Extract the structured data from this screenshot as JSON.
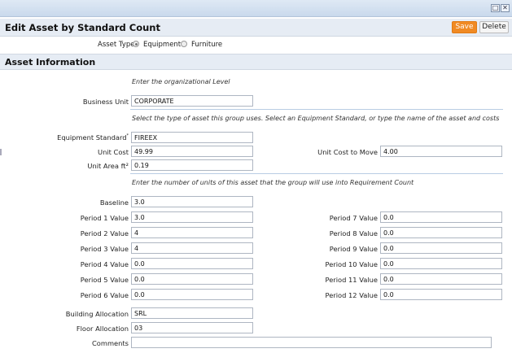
{
  "window": {
    "restore_glyph": "□",
    "close_glyph": "✕"
  },
  "header": {
    "title": "Edit Asset by Standard Count",
    "save_label": "Save",
    "delete_label": "Delete"
  },
  "asset_type": {
    "label": "Asset Type",
    "options": [
      "Equipment",
      "Furniture"
    ],
    "selected": "Equipment"
  },
  "section": {
    "title": "Asset Information"
  },
  "instructions": {
    "org_level": "Enter the organizational Level",
    "asset_type": "Select the type of asset this group uses. Select an Equipment Standard, or type the name of the asset and costs",
    "units": "Enter the number of units of this asset that the group will use into Requirement Count"
  },
  "fields": {
    "business_unit": {
      "label": "Business Unit",
      "value": "CORPORATE"
    },
    "equipment_standard": {
      "label": "Equipment Standard",
      "required_mark": "*",
      "value": "FIREEX"
    },
    "unit_cost": {
      "label": "Unit Cost",
      "value": "49.99"
    },
    "unit_cost_to_move": {
      "label": "Unit Cost to Move",
      "value": "4.00"
    },
    "unit_area": {
      "label": "Unit Area ft²",
      "value": "0.19"
    },
    "baseline": {
      "label": "Baseline",
      "value": "3.0"
    },
    "periods_left": [
      {
        "label": "Period 1 Value",
        "value": "3.0"
      },
      {
        "label": "Period 2 Value",
        "value": "4"
      },
      {
        "label": "Period 3 Value",
        "value": "4"
      },
      {
        "label": "Period 4 Value",
        "value": "0.0"
      },
      {
        "label": "Period 5 Value",
        "value": "0.0"
      },
      {
        "label": "Period 6 Value",
        "value": "0.0"
      }
    ],
    "periods_right": [
      {
        "label": "Period 7 Value",
        "value": "0.0"
      },
      {
        "label": "Period 8 Value",
        "value": "0.0"
      },
      {
        "label": "Period 9 Value",
        "value": "0.0"
      },
      {
        "label": "Period 10 Value",
        "value": "0.0"
      },
      {
        "label": "Period 11 Value",
        "value": "0.0"
      },
      {
        "label": "Period 12 Value",
        "value": "0.0"
      }
    ],
    "building_allocation": {
      "label": "Building Allocation",
      "value": "SRL"
    },
    "floor_allocation": {
      "label": "Floor Allocation",
      "value": "03"
    },
    "comments": {
      "label": "Comments",
      "value": ""
    }
  },
  "colors": {
    "save_button": "#f08a24",
    "header_bg": "#e6ecf4",
    "separator": "#b9cde4"
  }
}
